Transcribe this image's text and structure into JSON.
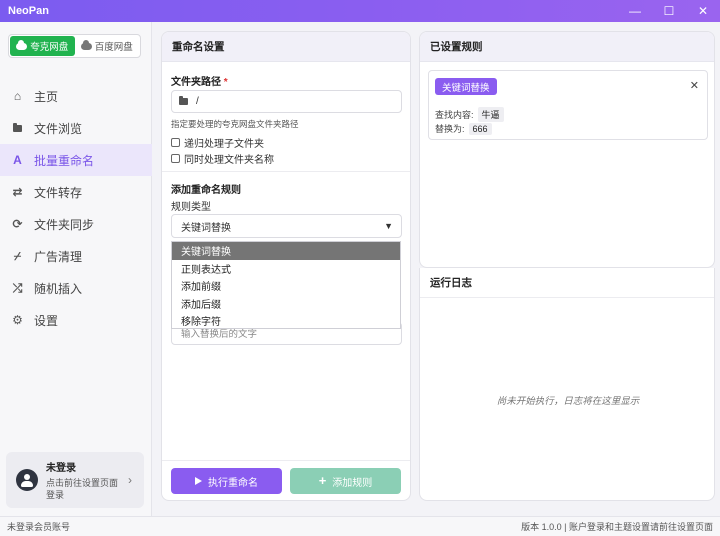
{
  "app": {
    "title": "NeoPan"
  },
  "window_controls": {
    "minimize": "—",
    "maximize": "☐",
    "close": "✕"
  },
  "drives": [
    {
      "label": "夸克网盘",
      "active": true
    },
    {
      "label": "百度网盘",
      "active": false
    }
  ],
  "nav": [
    {
      "label": "主页",
      "icon": "home-icon",
      "glyph": "⌂"
    },
    {
      "label": "文件浏览",
      "icon": "folder-icon",
      "glyph": "▬"
    },
    {
      "label": "批量重命名",
      "icon": "font-icon",
      "glyph": "A",
      "active": true
    },
    {
      "label": "文件转存",
      "icon": "exchange-icon",
      "glyph": "⇄"
    },
    {
      "label": "文件夹同步",
      "icon": "sync-icon",
      "glyph": "⟳"
    },
    {
      "label": "广告清理",
      "icon": "broom-icon",
      "glyph": "⌿"
    },
    {
      "label": "随机插入",
      "icon": "shuffle-icon",
      "glyph": "⤮"
    },
    {
      "label": "设置",
      "icon": "gear-icon",
      "glyph": "⚙"
    }
  ],
  "user": {
    "name": "未登录",
    "hint": "点击前往设置页面登录",
    "chevron": "›"
  },
  "rename": {
    "title": "重命名设置",
    "folder_label": "文件夹路径",
    "required_mark": "*",
    "folder_value": "/",
    "folder_help": "指定要处理的夸克网盘文件夹路径",
    "recursive_label": "递归处理子文件夹",
    "include_folders_label": "同时处理文件夹名称",
    "add_rule_title": "添加重命名规则",
    "rule_type_label": "规则类型",
    "rule_type_value": "关键词替换",
    "rule_type_options": [
      "关键词替换",
      "正则表达式",
      "添加前缀",
      "添加后缀",
      "移除字符"
    ],
    "replace_placeholder": "输入替换后的文字",
    "run_button": "执行重命名",
    "add_button": "添加规则",
    "add_plus": "+"
  },
  "rules": {
    "title": "已设置规则",
    "items": [
      {
        "tag": "关键词替换",
        "find_label": "查找内容:",
        "find_value": "牛逼",
        "replace_label": "替换为:",
        "replace_value": "666",
        "close": "✕"
      }
    ]
  },
  "log": {
    "title": "运行日志",
    "empty": "尚未开始执行，日志将在这里显示"
  },
  "status": {
    "left": "未登录会员账号",
    "right": "版本 1.0.0 | 账户登录和主题设置请前往设置页面"
  },
  "colors": {
    "accent": "#8a5cf0",
    "quark_green": "#21b34f",
    "add_button": "#8bcfb5"
  }
}
